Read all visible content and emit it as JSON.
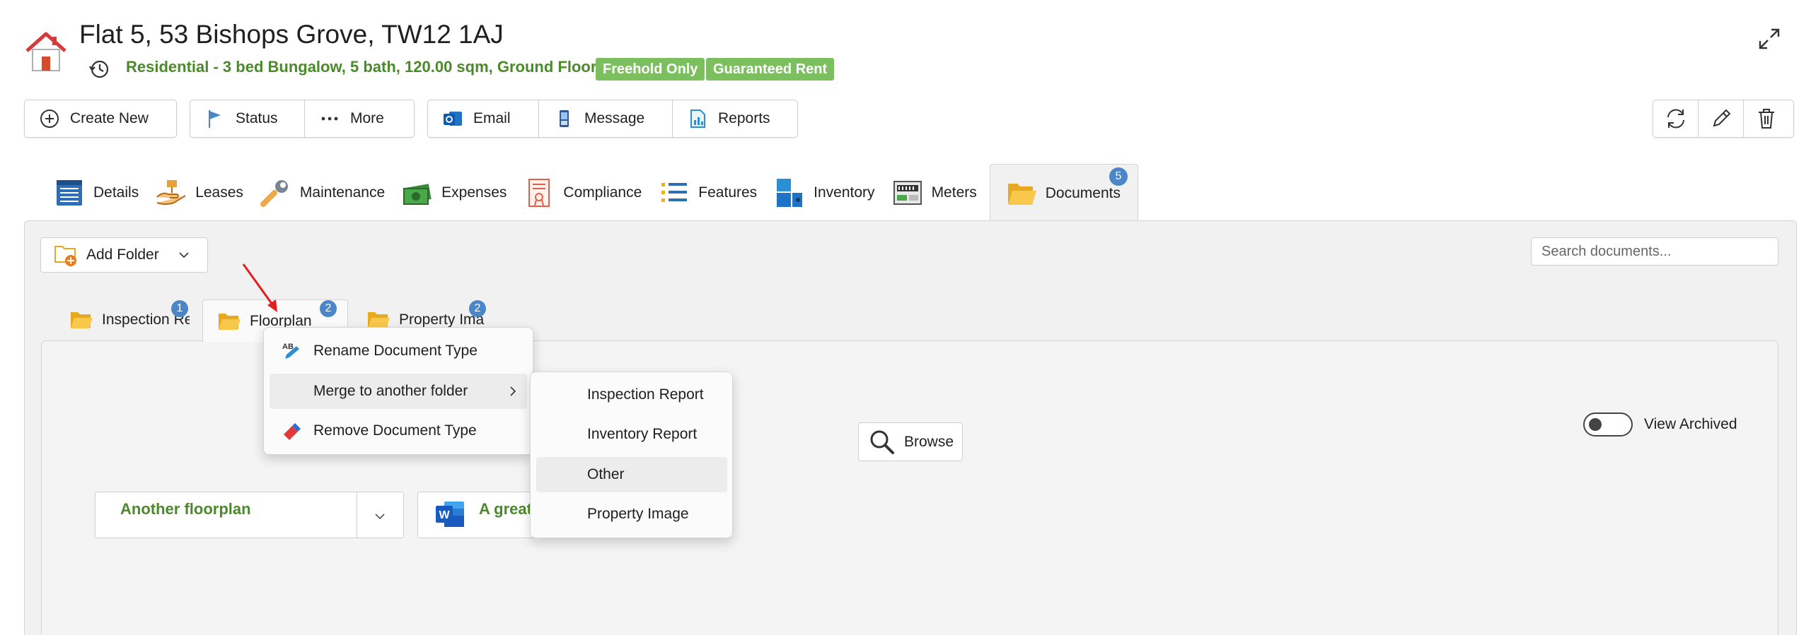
{
  "header": {
    "title": "Flat 5,  53 Bishops Grove, TW12 1AJ",
    "subtitle": "Residential - 3 bed Bungalow, 5 bath, 120.00 sqm, Ground Floor",
    "badges": [
      "Freehold Only",
      "Guaranteed Rent"
    ]
  },
  "toolbar": {
    "create_new": "Create New",
    "status": "Status",
    "more": "More",
    "email": "Email",
    "message": "Message",
    "reports": "Reports"
  },
  "tabs": [
    {
      "label": "Details",
      "icon": "details-icon"
    },
    {
      "label": "Leases",
      "icon": "leases-icon"
    },
    {
      "label": "Maintenance",
      "icon": "maintenance-icon"
    },
    {
      "label": "Expenses",
      "icon": "expenses-icon"
    },
    {
      "label": "Compliance",
      "icon": "compliance-icon"
    },
    {
      "label": "Features",
      "icon": "features-icon"
    },
    {
      "label": "Inventory",
      "icon": "inventory-icon"
    },
    {
      "label": "Meters",
      "icon": "meters-icon"
    },
    {
      "label": "Documents",
      "icon": "documents-icon",
      "count": "5",
      "active": true
    }
  ],
  "documents": {
    "add_folder": "Add Folder",
    "search_placeholder": "Search documents...",
    "folder_tabs": [
      {
        "label": "Inspection Re",
        "count": "1"
      },
      {
        "label": "Floorplan",
        "count": "2",
        "active": true
      },
      {
        "label": "Property Ima",
        "count": "2"
      }
    ],
    "browse": "Browse",
    "view_archived": "View Archived",
    "cards": [
      {
        "title": "Another floorplan"
      },
      {
        "title": "A great"
      }
    ]
  },
  "context_menu": {
    "items": [
      "Rename Document Type",
      "Merge to another folder",
      "Remove Document Type"
    ],
    "submenu": [
      "Inspection Report",
      "Inventory Report",
      "Other",
      "Property Image"
    ]
  },
  "colors": {
    "accent_green": "#4a8a2a",
    "badge_green": "#7cbf5f",
    "count_blue": "#4a86c8"
  }
}
